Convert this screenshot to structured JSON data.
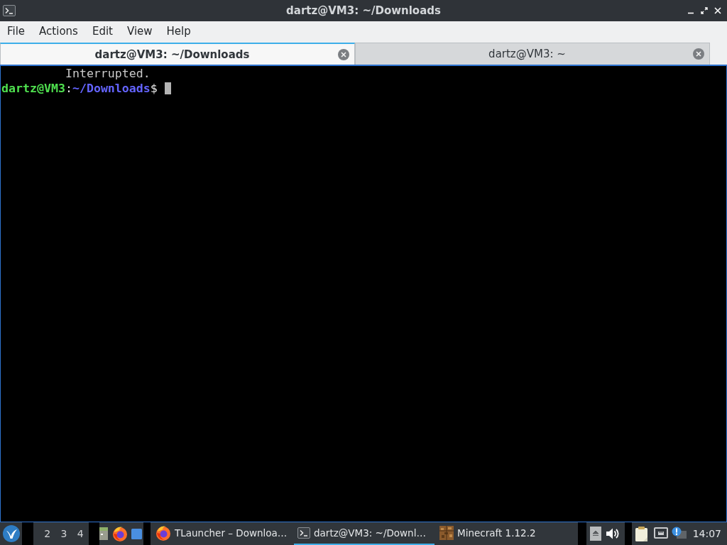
{
  "window": {
    "title": "dartz@VM3: ~/Downloads"
  },
  "menu": [
    "File",
    "Actions",
    "Edit",
    "View",
    "Help"
  ],
  "tabs": [
    {
      "label": "dartz@VM3: ~/Downloads",
      "selected": true
    },
    {
      "label": "dartz@VM3: ~",
      "selected": false
    }
  ],
  "terminal": {
    "lines": [
      {
        "kind": "output",
        "text": "Interrupted."
      },
      {
        "kind": "prompt",
        "user_host": "dartz@VM3",
        "separator": ":",
        "path": "~/Downloads",
        "symbol": "$"
      }
    ],
    "cursor": true
  },
  "taskbar": {
    "workspaces": [
      "2",
      "3",
      "4"
    ],
    "tasks": [
      {
        "kind": "browser",
        "label": "TLauncher – Downloa…",
        "selected": false
      },
      {
        "kind": "terminal",
        "label": "dartz@VM3: ~/Downl…",
        "selected": true
      },
      {
        "kind": "game",
        "label": "Minecraft 1.12.2",
        "selected": false
      }
    ],
    "clock": "14:07"
  }
}
